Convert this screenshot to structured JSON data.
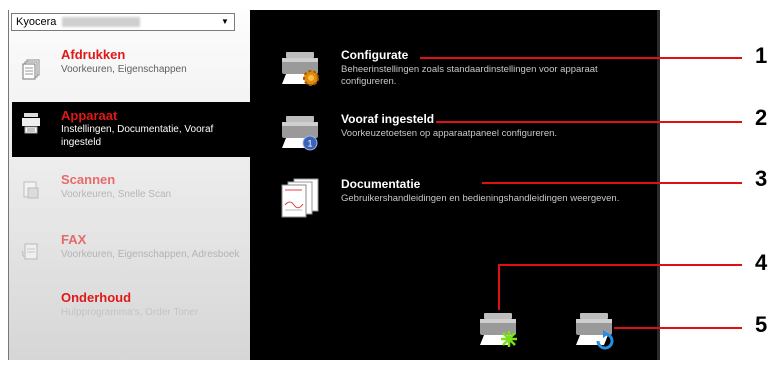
{
  "device_select": {
    "value": "Kyocera"
  },
  "nav": [
    {
      "title": "Afdrukken",
      "subtitle": "Voorkeuren, Eigenschappen",
      "icon": "document-icon",
      "state": "normal"
    },
    {
      "title": "Apparaat",
      "subtitle": "Instellingen, Documentatie, Vooraf ingesteld",
      "icon": "device-icon",
      "state": "active"
    },
    {
      "title": "Scannen",
      "subtitle": "Voorkeuren, Snelle Scan",
      "icon": "scanner-icon",
      "state": "dim"
    },
    {
      "title": "FAX",
      "subtitle": "Voorkeuren, Eigenschappen, Adresboek",
      "icon": "fax-icon",
      "state": "dim"
    },
    {
      "title": "Onderhoud",
      "subtitle": "Hulpprogramma's, Order Toner",
      "icon": "",
      "state": "dim"
    }
  ],
  "actions": [
    {
      "title": "Configurate",
      "description": "Beheerinstellingen zoals standaardinstellingen voor apparaat configureren.",
      "icon": "printer-gear-icon"
    },
    {
      "title": "Vooraf ingesteld",
      "description": "Voorkeuzetoetsen op apparaatpaneel configureren.",
      "icon": "printer-preset-icon"
    },
    {
      "title": "Documentatie",
      "description": "Gebruikershandleidingen en bedieningshandleidingen weergeven.",
      "icon": "manuals-icon"
    }
  ],
  "bottom_icons": [
    "printer-add-icon",
    "printer-refresh-icon"
  ],
  "callouts": [
    "1",
    "2",
    "3",
    "4",
    "5"
  ],
  "colors": {
    "accent": "#e01818",
    "panel": "#000000",
    "callout": "#e01010"
  }
}
